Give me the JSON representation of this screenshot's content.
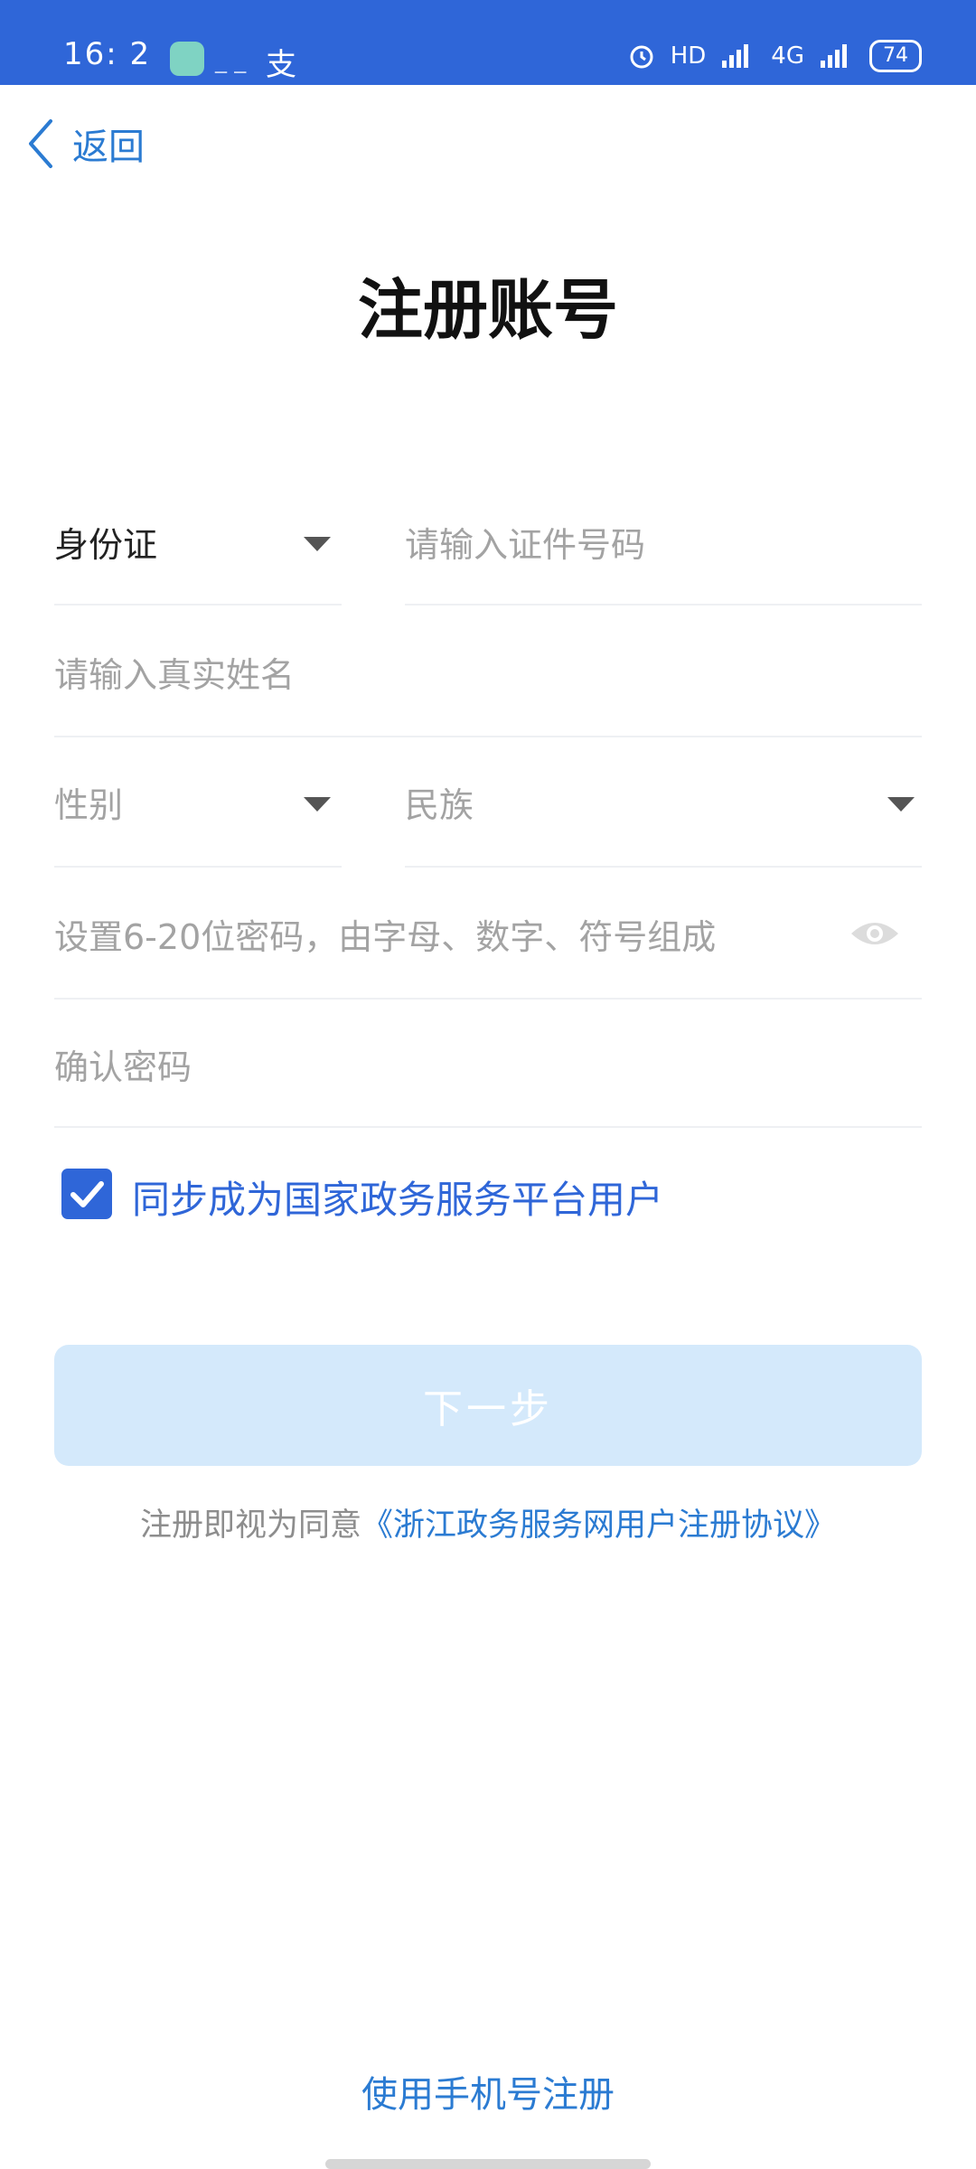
{
  "status_bar": {
    "time": "16: 2",
    "app_icons": "_ _",
    "app_label": "支",
    "network": "HD",
    "network_type": "4G",
    "battery": "74",
    "color": "#2f66d8"
  },
  "nav": {
    "back_label": "返回"
  },
  "page": {
    "title": "注册账号"
  },
  "form": {
    "id_type_selected": "身份证",
    "id_number_placeholder": "请输入证件号码",
    "name_placeholder": "请输入真实姓名",
    "gender_placeholder": "性别",
    "ethnicity_placeholder": "民族",
    "password_placeholder": "设置6-20位密码，由字母、数字、符号组成",
    "confirm_password_placeholder": "确认密码",
    "sync_checkbox_label": "同步成为国家政务服务平台用户",
    "sync_checked": true,
    "next_button_label": "下一步"
  },
  "agreement": {
    "prefix": "注册即视为同意",
    "link": "《浙江政务服务网用户注册协议》"
  },
  "footer": {
    "phone_register_label": "使用手机号注册"
  },
  "colors": {
    "primary": "#2f66d8",
    "link": "#2b7bd2",
    "button_disabled": "#d4e9fb"
  }
}
